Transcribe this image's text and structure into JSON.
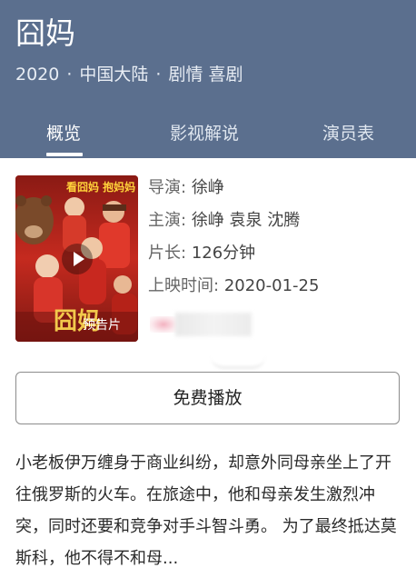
{
  "header": {
    "title": "囧妈",
    "year": "2020",
    "region": "中国大陆",
    "genres": "剧情 喜剧",
    "separator": "·"
  },
  "tabs": [
    {
      "label": "概览",
      "active": true
    },
    {
      "label": "影视解说",
      "active": false
    },
    {
      "label": "演员表",
      "active": false
    }
  ],
  "poster": {
    "top_text": "看囧妈 抱妈妈",
    "logo_text": "囧妈",
    "badge": "预告片",
    "play_icon": "play-icon"
  },
  "info": {
    "director": {
      "key": "导演:",
      "value": "徐峥"
    },
    "cast": {
      "key": "主演:",
      "value": "徐峥 袁泉 沈腾"
    },
    "runtime": {
      "key": "片长:",
      "value": "126分钟"
    },
    "release": {
      "key": "上映时间:",
      "value": "2020-01-25"
    }
  },
  "actions": {
    "play_free": "免费播放"
  },
  "synopsis": "小老板伊万缠身于商业纠纷，却意外同母亲坐上了开往俄罗斯的火车。在旅途中，他和母亲发生激烈冲突，同时还要和竞争对手斗智斗勇。 为了最终抵达莫斯科，他不得不和母...",
  "colors": {
    "header_bg": "#5b6f8e",
    "header_text": "#ffffff",
    "poster_red": "#b2231b"
  }
}
